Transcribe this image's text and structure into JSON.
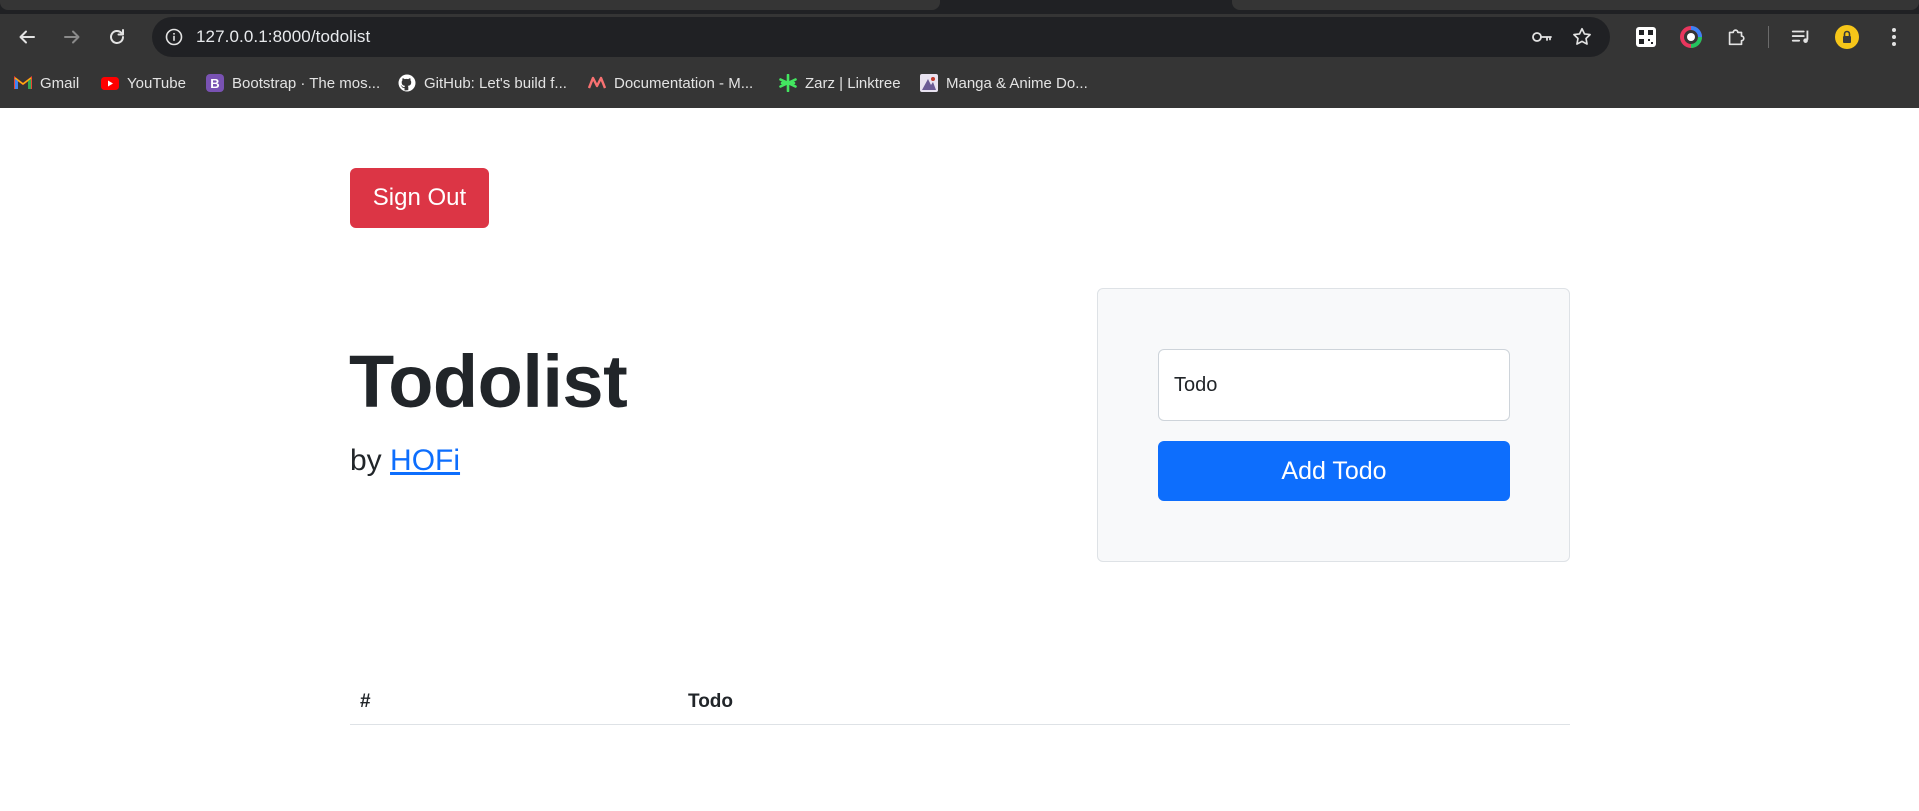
{
  "browser": {
    "url": "127.0.0.1:8000/todolist",
    "bookmarks": [
      {
        "label": "Gmail",
        "icon": "gmail-icon"
      },
      {
        "label": "YouTube",
        "icon": "youtube-icon"
      },
      {
        "label": "Bootstrap · The mos...",
        "icon": "bootstrap-icon"
      },
      {
        "label": "GitHub: Let's build f...",
        "icon": "github-icon"
      },
      {
        "label": "Documentation - M...",
        "icon": "documentation-icon"
      },
      {
        "label": "Zarz | Linktree",
        "icon": "linktree-icon"
      },
      {
        "label": "Manga & Anime Do...",
        "icon": "manga-icon"
      }
    ]
  },
  "page": {
    "signout_label": "Sign Out",
    "title": "Todolist",
    "byline_prefix": "by",
    "author": "HOFi",
    "input_placeholder": "Todo",
    "add_button_label": "Add Todo",
    "table_headers": [
      "#",
      "Todo"
    ]
  },
  "colors": {
    "danger": "#dc3545",
    "primary": "#0d6efd",
    "card_bg": "#f8f9fa",
    "text": "#212529",
    "chrome_bg": "#353535"
  }
}
